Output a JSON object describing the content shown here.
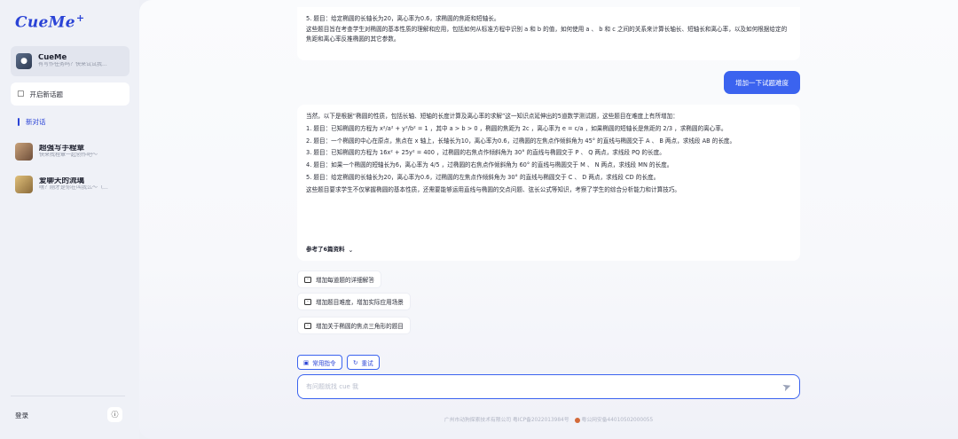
{
  "sidebar": {
    "logo": "CueMe",
    "logo_plus": "+",
    "agent": {
      "title": "CueMe",
      "subtitle": "有写作任务吗？快来试试我..."
    },
    "new_topic": "开启新话题",
    "current": "新对话",
    "conversations": [
      {
        "title": "超强写手程章",
        "subtitle": "快来找程章一起创作吧～"
      },
      {
        "title": "爱聊天的流璃",
        "subtitle": "嘿？刚才是你在叫我么～（..."
      }
    ],
    "login": "登录"
  },
  "main": {
    "previous_item": "5. 题目：给定椭圆的长轴长为20，离心率为0.6，求椭圆的焦距和短轴长。",
    "previous_summary": "这些题目旨在考查学生对椭圆的基本性质的理解和应用，包括如何从标准方程中识别 a 和 b 的值，如何使用 a 、 b 和 c 之间的关系来计算长轴长、短轴长和离心率，以及如何根据给定的焦距和离心率反推椭圆的其它参数。",
    "user_message": "增加一下试题难度",
    "answer": {
      "intro": "当然，以下是根据“椭圆的性质，包括长轴、短轴的长度计算及离心率的求解”这一知识点延伸出的5道数学测试题，这些题目在难度上有所增加：",
      "items": [
        "1. 题目：已知椭圆的方程为 x²/a² + y²/b² = 1 ，其中 a > b > 0 ，椭圆的焦距为 2c ，离心率为 e = c/a ，如果椭圆的短轴长是焦距的 2/3 ，求椭圆的离心率。",
        "2. 题目：一个椭圆的中心在原点，焦点在 x 轴上，长轴长为10，离心率为0.6，过椭圆的左焦点作倾斜角为 45° 的直线与椭圆交于 A 、 B 两点，求线段 AB 的长度。",
        "3. 题目：已知椭圆的方程为 16x² + 25y² = 400 ，过椭圆的右焦点作倾斜角为 30° 的直线与椭圆交于 P 、 Q 两点，求线段 PQ 的长度。",
        "4. 题目：如果一个椭圆的短轴长为6，离心率为 4/5 ，过椭圆的右焦点作倾斜角为 60° 的直线与椭圆交于 M 、 N 两点，求线段 MN 的长度。",
        "5. 题目：给定椭圆的长轴长为20，离心率为0.6，过椭圆的左焦点作倾斜角为 30° 的直线与椭圆交于 C 、 D 两点，求线段 CD 的长度。"
      ],
      "outro": "这些题目要求学生不仅掌握椭圆的基本性质，还需要能够运用直线与椭圆的交点问题、弦长公式等知识，考察了学生的综合分析能力和计算技巧。",
      "references": "参考了6篇资料"
    },
    "suggestions": [
      "增加每道题的详细解答",
      "增加题目难度，增加实际应用场景",
      "增加关于椭圆的焦点三角形的题目"
    ],
    "tools": {
      "common": "常用指令",
      "retry": "重试"
    },
    "input_placeholder": "有问题就找 cue 我",
    "footer": {
      "company": "广州市动狗探索技术有限公司 粤ICP备2022013984号",
      "police": "粤公网安备44010502000055"
    }
  }
}
